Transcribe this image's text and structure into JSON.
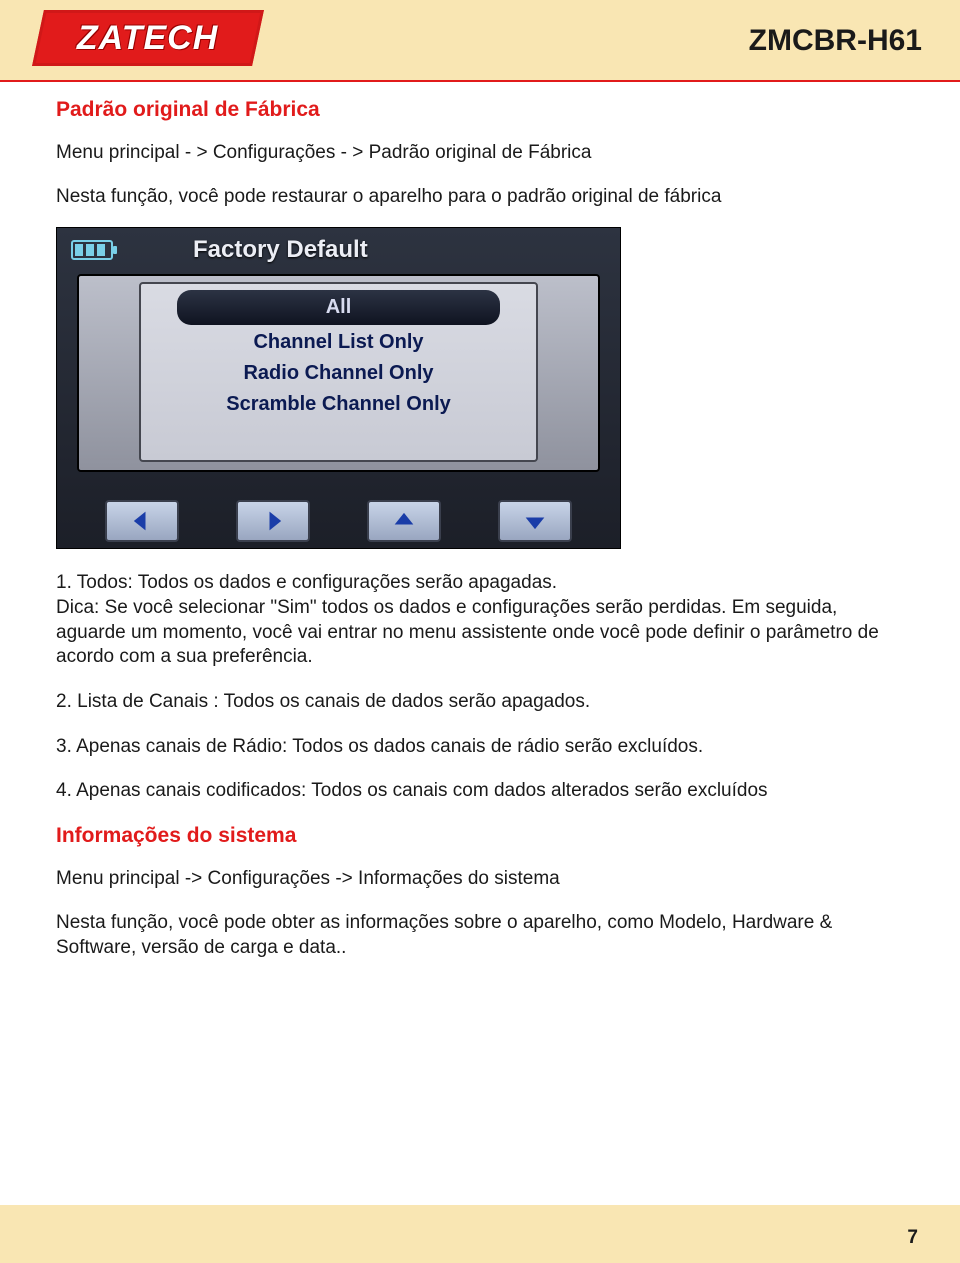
{
  "brand": "ZATECH",
  "model": "ZMCBR-H61",
  "section1": {
    "title": "Padrão original de Fábrica",
    "breadcrumb": "Menu principal - > Configurações - > Padrão original de Fábrica",
    "intro": "Nesta função, você pode restaurar o aparelho para o padrão original de fábrica"
  },
  "device_screen": {
    "title": "Factory Default",
    "options": [
      "All",
      "Channel List Only",
      "Radio Channel Only",
      "Scramble Channel Only"
    ]
  },
  "list": {
    "item1": "1. Todos: Todos os dados e configurações serão apagadas.\nDica: Se você selecionar \"Sim\" todos os dados e configurações serão perdidas. Em seguida, aguarde um momento, você vai entrar no menu assistente onde você pode definir o parâmetro de acordo com a sua preferência.",
    "item2": "2. Lista de Canais : Todos os canais de dados serão apagados.",
    "item3": "3. Apenas canais de Rádio: Todos os dados canais de rádio serão excluídos.",
    "item4": "4. Apenas canais codificados: Todos os canais com dados alterados serão excluídos"
  },
  "section2": {
    "title": "Informações do sistema",
    "breadcrumb": "Menu principal -> Configurações -> Informações do sistema",
    "intro": "Nesta função, você pode obter as informações sobre o aparelho, como Modelo, Hardware & Software, versão de carga e data.."
  },
  "page_number": "7"
}
